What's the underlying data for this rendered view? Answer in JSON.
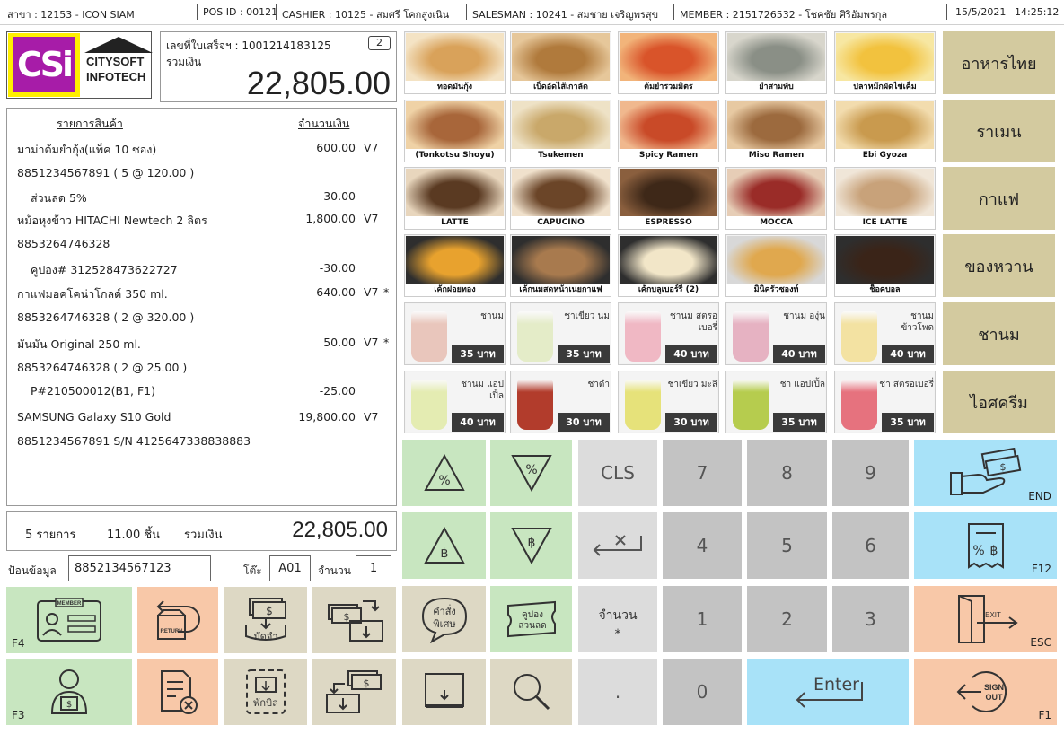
{
  "status": {
    "branch": "สาขา : 12153 - ICON SIAM",
    "pos_id": "POS ID : 00121",
    "cashier": "CASHIER : 10125 - สมศรี โคกสูงเนิน",
    "salesman": "SALESMAN : 10241 - สมชาย เจริญพรสุข",
    "member": "MEMBER : 2151726532 - โชคชัย ศิริอัมพรกุล",
    "date": "15/5/2021",
    "time": "14:25:12"
  },
  "logo": {
    "mark": "CSi",
    "line1": "CITYSOFT",
    "line2": "INFOTECH"
  },
  "receipt": {
    "number": "เลขที่ใบเสร็จฯ : 1001214183125",
    "total_label": "รวมเงิน",
    "total": "22,805.00",
    "badge": "2"
  },
  "items": {
    "header_name": "รายการสินค้า",
    "header_amount": "จำนวนเงิน",
    "rows": [
      {
        "name": "มาม่าต้มยำกุ้ง(แพ็ค 10 ซอง)",
        "amount": "600.00",
        "vat": "V7",
        "flag": "",
        "indent": false
      },
      {
        "name": "8851234567891 ( 5 @ 120.00 )",
        "amount": "",
        "vat": "",
        "flag": "",
        "indent": false
      },
      {
        "name": "ส่วนลด 5%",
        "amount": "-30.00",
        "vat": "",
        "flag": "",
        "indent": true
      },
      {
        "name": "หม้อหุงข้าว HITACHI Newtech 2 ลิตร",
        "amount": "1,800.00",
        "vat": "V7",
        "flag": "",
        "indent": false
      },
      {
        "name": "8853264746328",
        "amount": "",
        "vat": "",
        "flag": "",
        "indent": false
      },
      {
        "name": "คูปอง# 312528473622727",
        "amount": "-30.00",
        "vat": "",
        "flag": "",
        "indent": true
      },
      {
        "name": "กาแฟมอคโคน่าโกลด์ 350 ml.",
        "amount": "640.00",
        "vat": "V7",
        "flag": "*",
        "indent": false
      },
      {
        "name": "8853264746328 ( 2 @ 320.00 )",
        "amount": "",
        "vat": "",
        "flag": "",
        "indent": false
      },
      {
        "name": "มันมัน Original 250 ml.",
        "amount": "50.00",
        "vat": "V7",
        "flag": "*",
        "indent": false
      },
      {
        "name": "8853264746328 ( 2 @ 25.00 )",
        "amount": "",
        "vat": "",
        "flag": "",
        "indent": false
      },
      {
        "name": "P#210500012(B1, F1)",
        "amount": "-25.00",
        "vat": "",
        "flag": "",
        "indent": true
      },
      {
        "name": "SAMSUNG Galaxy S10 Gold",
        "amount": "19,800.00",
        "vat": "V7",
        "flag": "",
        "indent": false
      },
      {
        "name": "8851234567891  S/N 4125647338838883",
        "amount": "",
        "vat": "",
        "flag": "",
        "indent": false
      }
    ]
  },
  "totals": {
    "count": "5 รายการ",
    "qty": "11.00  ชิ้น",
    "label": "รวมเงิน",
    "amount": "22,805.00"
  },
  "input": {
    "data_label": "ป้อนข้อมูล",
    "data_value": "8852134567123",
    "table_label": "โต๊ะ",
    "table_value": "A01",
    "qty_label": "จำนวน",
    "qty_value": "1"
  },
  "food": [
    {
      "caption": "ทอดมันกุ้ง",
      "c1": "#d9a25a",
      "c2": "#f4e3c4"
    },
    {
      "caption": "เป็ดอัดไส้เกาลัด",
      "c1": "#b07a3c",
      "c2": "#e6c79a"
    },
    {
      "caption": "ต้มยำรวมมิตร",
      "c1": "#d9542a",
      "c2": "#f2b47a"
    },
    {
      "caption": "ยำสามทับ",
      "c1": "#8a8f86",
      "c2": "#d8d6cc"
    },
    {
      "caption": "ปลาหมึกผัดไข่เค็ม",
      "c1": "#f2c23e",
      "c2": "#f7e7a2"
    },
    {
      "caption": "(Tonkotsu Shoyu)",
      "c1": "#a8663a",
      "c2": "#efd2a6"
    },
    {
      "caption": "Tsukemen",
      "c1": "#c9a86a",
      "c2": "#eee2c6"
    },
    {
      "caption": "Spicy Ramen",
      "c1": "#c94a28",
      "c2": "#f0b88e"
    },
    {
      "caption": "Miso Ramen",
      "c1": "#9c6a3e",
      "c2": "#e7c9a2"
    },
    {
      "caption": "Ebi Gyoza",
      "c1": "#c99a4e",
      "c2": "#f2dcae"
    },
    {
      "caption": "LATTE",
      "c1": "#5a3a22",
      "c2": "#e8d6bd"
    },
    {
      "caption": "CAPUCINO",
      "c1": "#6b4528",
      "c2": "#f0e1cc"
    },
    {
      "caption": "ESPRESSO",
      "c1": "#3e2818",
      "c2": "#8a5f3e"
    },
    {
      "caption": "MOCCA",
      "c1": "#9a2c28",
      "c2": "#e6cdb6"
    },
    {
      "caption": "ICE LATTE",
      "c1": "#c8a27a",
      "c2": "#f0e6d8"
    },
    {
      "caption": "เค้กฝอยทอง",
      "c1": "#e8a22e",
      "c2": "#2e2e2e"
    },
    {
      "caption": "เค้กนมสดหน้าเนยกาแฟ",
      "c1": "#a87a4e",
      "c2": "#2e2e2e"
    },
    {
      "caption": "เค้กบลูเบอร์รี่ (2)",
      "c1": "#f2e6c8",
      "c2": "#2e2e2e"
    },
    {
      "caption": "มินิครัวซองท์",
      "c1": "#e0a84e",
      "c2": "#d8d8d8"
    },
    {
      "caption": "ช็อคบอล",
      "c1": "#3a2418",
      "c2": "#2e2e2e"
    }
  ],
  "drinks": [
    {
      "name": "ชานม",
      "price": "35 บาท",
      "color": "#e9c6bc"
    },
    {
      "name": "ชาเขียว นม",
      "price": "35 บาท",
      "color": "#e4ecc8"
    },
    {
      "name": "ชานม สตรอเบอรี่",
      "price": "40 บาท",
      "color": "#f0b8c4"
    },
    {
      "name": "ชานม องุ่น",
      "price": "40 บาท",
      "color": "#e6b2c2"
    },
    {
      "name": "ชานม ข้าวโพด",
      "price": "40 บาท",
      "color": "#f3e2a2"
    },
    {
      "name": "ชานม แอปเปิ้ล",
      "price": "40 บาท",
      "color": "#e4ecb2"
    },
    {
      "name": "ชาดำ",
      "price": "30 บาท",
      "color": "#b23c2c"
    },
    {
      "name": "ชาเขียว มะลิ",
      "price": "30 บาท",
      "color": "#e6e27a"
    },
    {
      "name": "ชา แอปเปิ้ล",
      "price": "35 บาท",
      "color": "#b6cc4e"
    },
    {
      "name": "ชา สตรอเบอรี่",
      "price": "35 บาท",
      "color": "#e6727e"
    }
  ],
  "categories": [
    "อาหารไทย",
    "ราเมน",
    "กาแฟ",
    "ของหวาน",
    "ชานม",
    "ไอศครีม"
  ],
  "keys": {
    "cls": "CLS",
    "n7": "7",
    "n8": "8",
    "n9": "9",
    "n4": "4",
    "n5": "5",
    "n6": "6",
    "n1": "1",
    "n2": "2",
    "n3": "3",
    "n0": "0",
    "dot": ".",
    "qty_line1": "จำนวน",
    "qty_line2": "*",
    "enter": "Enter",
    "end": "END",
    "f12": "F12",
    "esc": "ESC",
    "f1": "F1",
    "f4": "F4",
    "f3": "F3",
    "pct": "%",
    "baht": "฿",
    "member_tag": "MEMBER",
    "return_tag": "RETURN",
    "deposit": "มัดจำ",
    "special_1": "คำสั่ง",
    "special_2": "พิเศษ",
    "coupon_1": "คูปอง",
    "coupon_2": "ส่วนลด",
    "hold": "พักบิล",
    "exit": "EXIT",
    "sign_1": "SIGN",
    "sign_2": "OUT"
  },
  "colors": {
    "green": "#c8e6c0",
    "salmon": "#f8c8a8",
    "tan": "#ddd8c4",
    "lightgray": "#dcdcdc",
    "midgray": "#c3c3c3",
    "cyan": "#a8e2f8",
    "khaki": "#d3ca9f",
    "logo_yellow": "#ffef00",
    "logo_purple": "#a71ca8"
  }
}
